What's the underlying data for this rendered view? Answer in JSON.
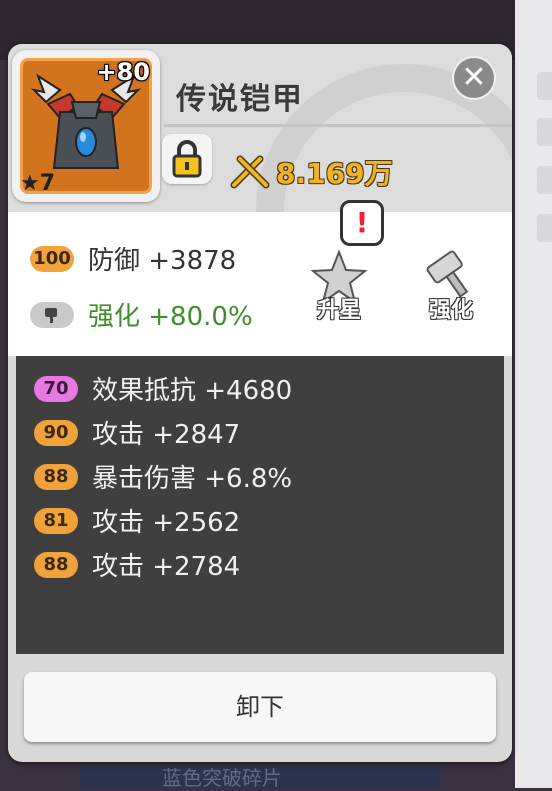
{
  "item": {
    "name": "传说铠甲",
    "enhance_level": "+80",
    "star_count": "★7",
    "power_value": "8.169万"
  },
  "main_stats": [
    {
      "badge": "100",
      "text": "防御 +3878"
    },
    {
      "badge_icon": "hammer-icon",
      "text": "强化 +80.0%"
    }
  ],
  "actions": {
    "star_up_label": "升星",
    "enhance_label": "强化",
    "alert_mark": "!"
  },
  "sub_stats": [
    {
      "badge": "70",
      "text": "效果抵抗 +4680",
      "badge_color": "#e779e0"
    },
    {
      "badge": "90",
      "text": "攻击 +2847",
      "badge_color": "#f2a23a"
    },
    {
      "badge": "88",
      "text": "暴击伤害 +6.8%",
      "badge_color": "#f2a23a"
    },
    {
      "badge": "81",
      "text": "攻击 +2562",
      "badge_color": "#f2a23a"
    },
    {
      "badge": "88",
      "text": "攻击 +2784",
      "badge_color": "#f2a23a"
    }
  ],
  "buttons": {
    "unequip_label": "卸下",
    "close_symbol": "✕"
  },
  "background": {
    "bottom_text": "蓝色突破碎片"
  },
  "colors": {
    "gold_badge": "#f2a23a",
    "pink_badge": "#e779e0",
    "green_text": "#3f8e2c",
    "power_text": "#f2b320"
  }
}
